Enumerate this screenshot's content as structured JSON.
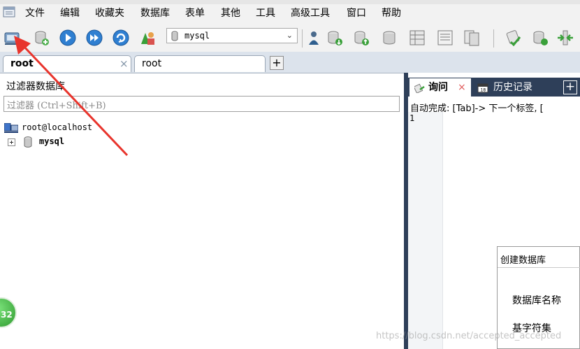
{
  "menubar": {
    "items": [
      "文件",
      "编辑",
      "收藏夹",
      "数据库",
      "表单",
      "其他",
      "工具",
      "高级工具",
      "窗口",
      "帮助"
    ]
  },
  "toolbar": {
    "selected_database": "mysql"
  },
  "connection_tabs": [
    {
      "label": "root"
    },
    {
      "label": "root"
    }
  ],
  "left_panel": {
    "title": "过滤器数据库",
    "filter_placeholder": "过滤器 (Ctrl+Shift+B)",
    "tree": {
      "host": "root@localhost",
      "databases": [
        {
          "name": "mysql"
        }
      ]
    }
  },
  "query_panel": {
    "tabs": [
      {
        "label": "询问"
      },
      {
        "label": "历史记录"
      }
    ],
    "autocomplete_hint": "自动完成: [Tab]-> 下一个标签, [",
    "line_numbers": [
      "1"
    ]
  },
  "create_db_dialog": {
    "title": "创建数据库",
    "fields": [
      {
        "label": "数据库名称"
      },
      {
        "label": "基字符集"
      }
    ]
  },
  "badge": {
    "count": "32"
  },
  "watermark": "https://blog.csdn.net/accepted_accepted",
  "colors": {
    "dark_panel": "#2e3f59",
    "arrow": "#e8342c",
    "badge": "#3fb23f"
  }
}
